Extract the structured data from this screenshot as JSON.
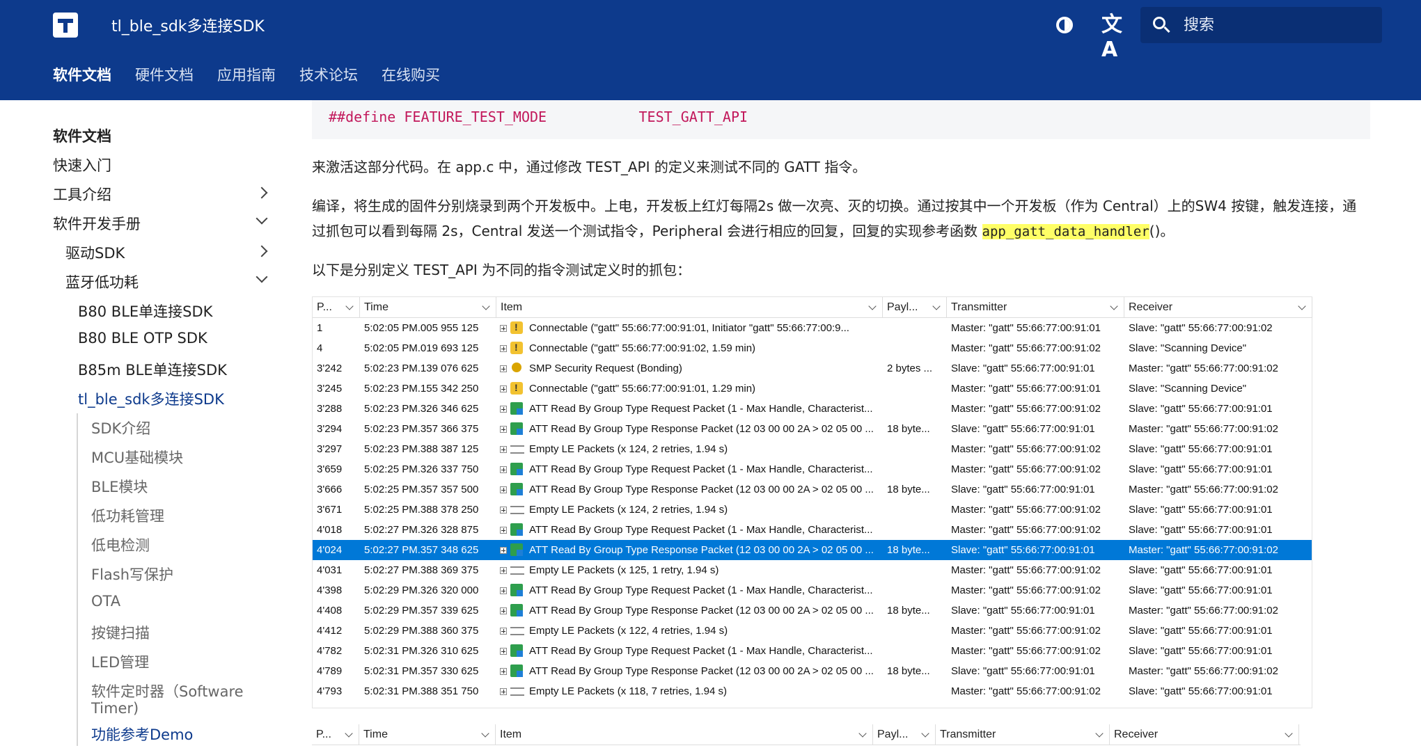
{
  "header": {
    "site_title": "tl_ble_sdk多连接SDK",
    "translate_glyph": "文A",
    "search_placeholder": "搜索",
    "tabs": [
      "软件文档",
      "硬件文档",
      "应用指南",
      "技术论坛",
      "在线购买"
    ]
  },
  "sidebar": {
    "items": [
      {
        "label": "软件文档"
      },
      {
        "label": "快速入门"
      },
      {
        "label": "工具介绍"
      },
      {
        "label": "软件开发手册"
      },
      {
        "label": "驱动SDK"
      },
      {
        "label": "蓝牙低功耗"
      },
      {
        "label": "B80 BLE单连接SDK"
      },
      {
        "label": "B80 BLE OTP SDK"
      },
      {
        "label": "B85m BLE单连接SDK"
      },
      {
        "label": "tl_ble_sdk多连接SDK"
      },
      {
        "label": "SDK介绍"
      },
      {
        "label": "MCU基础模块"
      },
      {
        "label": "BLE模块"
      },
      {
        "label": "低功耗管理"
      },
      {
        "label": "低电检测"
      },
      {
        "label": "Flash写保护"
      },
      {
        "label": "OTA"
      },
      {
        "label": "按键扫描"
      },
      {
        "label": "LED管理"
      },
      {
        "label": "软件定时器（Software"
      },
      {
        "label": "Timer)"
      },
      {
        "label": "功能参考Demo"
      }
    ]
  },
  "content": {
    "code_line": "##define FEATURE_TEST_MODE           TEST_GATT_API",
    "para1": "来激活这部分代码。在 app.c 中，通过修改 TEST_API 的定义来测试不同的 GATT 指令。",
    "para2_a": "编译，将生成的固件分别烧录到两个开发板中。上电，开发板上红灯每隔2s 做一次亮、灭的切换。通过按其中一个开发板（作为 Central）上的SW4 按键，触发连接，通过抓包可以看到每隔 2s，Central 发送一个测试指令，Peripheral 会进行相应的回复，回复的实现参考函数 ",
    "para2_code": "app_gatt_data_handler",
    "para2_b": "()。",
    "para3": "以下是分别定义 TEST_API 为不同的指令测试定义时的抓包："
  },
  "packet_table": {
    "columns": [
      "P...",
      "Time",
      "Item",
      "Payl...",
      "Transmitter",
      "Receiver"
    ],
    "selected_index": 11,
    "rows": [
      {
        "p": "1",
        "time": "5:02:05 PM.005 955 125",
        "icon": "connection-icon",
        "item": "Connectable (\"gatt\" 55:66:77:00:91:01, Initiator \"gatt\" 55:66:77:00:9...",
        "payload": "",
        "tx": "Master: \"gatt\" 55:66:77:00:91:01",
        "rx": "Slave: \"gatt\" 55:66:77:00:91:02"
      },
      {
        "p": "4",
        "time": "5:02:05 PM.019 693 125",
        "icon": "connection-icon",
        "item": "Connectable (\"gatt\" 55:66:77:00:91:02, 1.59 min)",
        "payload": "",
        "tx": "Master: \"gatt\" 55:66:77:00:91:02",
        "rx": "Slave: \"Scanning Device\""
      },
      {
        "p": "3'242",
        "time": "5:02:23 PM.139 076 625",
        "icon": "key-icon",
        "item": "SMP Security Request (Bonding)",
        "payload": "2 bytes ...",
        "tx": "Slave: \"gatt\" 55:66:77:00:91:01",
        "rx": "Master: \"gatt\" 55:66:77:00:91:02"
      },
      {
        "p": "3'245",
        "time": "5:02:23 PM.155 342 250",
        "icon": "connection-icon",
        "item": "Connectable (\"gatt\" 55:66:77:00:91:01, 1.29 min)",
        "payload": "",
        "tx": "Master: \"gatt\" 55:66:77:00:91:01",
        "rx": "Slave: \"Scanning Device\""
      },
      {
        "p": "3'288",
        "time": "5:02:23 PM.326 346 625",
        "icon": "att-icon",
        "item": "ATT Read By Group Type Request Packet (1 - Max Handle, Characterist...",
        "payload": "",
        "tx": "Master: \"gatt\" 55:66:77:00:91:02",
        "rx": "Slave: \"gatt\" 55:66:77:00:91:01"
      },
      {
        "p": "3'294",
        "time": "5:02:23 PM.357 366 375",
        "icon": "att-icon",
        "item": "ATT Read By Group Type Response Packet (12 03 00 00 2A > 02 05 00 ...",
        "payload": "18 byte...",
        "tx": "Slave: \"gatt\" 55:66:77:00:91:01",
        "rx": "Master: \"gatt\" 55:66:77:00:91:02"
      },
      {
        "p": "3'297",
        "time": "5:02:23 PM.388 387 125",
        "icon": "empty-packet-icon",
        "item": "Empty LE Packets (x 124, 2 retries, 1.94 s)",
        "payload": "",
        "tx": "Master: \"gatt\" 55:66:77:00:91:02",
        "rx": "Slave: \"gatt\" 55:66:77:00:91:01"
      },
      {
        "p": "3'659",
        "time": "5:02:25 PM.326 337 750",
        "icon": "att-icon",
        "item": "ATT Read By Group Type Request Packet (1 - Max Handle, Characterist...",
        "payload": "",
        "tx": "Master: \"gatt\" 55:66:77:00:91:02",
        "rx": "Slave: \"gatt\" 55:66:77:00:91:01"
      },
      {
        "p": "3'666",
        "time": "5:02:25 PM.357 357 500",
        "icon": "att-icon",
        "item": "ATT Read By Group Type Response Packet (12 03 00 00 2A > 02 05 00 ...",
        "payload": "18 byte...",
        "tx": "Slave: \"gatt\" 55:66:77:00:91:01",
        "rx": "Master: \"gatt\" 55:66:77:00:91:02"
      },
      {
        "p": "3'671",
        "time": "5:02:25 PM.388 378 250",
        "icon": "empty-packet-icon",
        "item": "Empty LE Packets (x 124, 2 retries, 1.94 s)",
        "payload": "",
        "tx": "Master: \"gatt\" 55:66:77:00:91:02",
        "rx": "Slave: \"gatt\" 55:66:77:00:91:01"
      },
      {
        "p": "4'018",
        "time": "5:02:27 PM.326 328 875",
        "icon": "att-icon",
        "item": "ATT Read By Group Type Request Packet (1 - Max Handle, Characterist...",
        "payload": "",
        "tx": "Master: \"gatt\" 55:66:77:00:91:02",
        "rx": "Slave: \"gatt\" 55:66:77:00:91:01"
      },
      {
        "p": "4'024",
        "time": "5:02:27 PM.357 348 625",
        "icon": "att-icon",
        "item": "ATT Read By Group Type Response Packet (12 03 00 00 2A > 02 05 00 ...",
        "payload": "18 byte...",
        "tx": "Slave: \"gatt\" 55:66:77:00:91:01",
        "rx": "Master: \"gatt\" 55:66:77:00:91:02"
      },
      {
        "p": "4'031",
        "time": "5:02:27 PM.388 369 375",
        "icon": "empty-packet-icon",
        "item": "Empty LE Packets (x 125, 1 retry, 1.94 s)",
        "payload": "",
        "tx": "Master: \"gatt\" 55:66:77:00:91:02",
        "rx": "Slave: \"gatt\" 55:66:77:00:91:01"
      },
      {
        "p": "4'398",
        "time": "5:02:29 PM.326 320 000",
        "icon": "att-icon",
        "item": "ATT Read By Group Type Request Packet (1 - Max Handle, Characterist...",
        "payload": "",
        "tx": "Master: \"gatt\" 55:66:77:00:91:02",
        "rx": "Slave: \"gatt\" 55:66:77:00:91:01"
      },
      {
        "p": "4'408",
        "time": "5:02:29 PM.357 339 625",
        "icon": "att-icon",
        "item": "ATT Read By Group Type Response Packet (12 03 00 00 2A > 02 05 00 ...",
        "payload": "18 byte...",
        "tx": "Slave: \"gatt\" 55:66:77:00:91:01",
        "rx": "Master: \"gatt\" 55:66:77:00:91:02"
      },
      {
        "p": "4'412",
        "time": "5:02:29 PM.388 360 375",
        "icon": "empty-packet-icon",
        "item": "Empty LE Packets (x 122, 4 retries, 1.94 s)",
        "payload": "",
        "tx": "Master: \"gatt\" 55:66:77:00:91:02",
        "rx": "Slave: \"gatt\" 55:66:77:00:91:01"
      },
      {
        "p": "4'782",
        "time": "5:02:31 PM.326 310 625",
        "icon": "att-icon",
        "item": "ATT Read By Group Type Request Packet (1 - Max Handle, Characterist...",
        "payload": "",
        "tx": "Master: \"gatt\" 55:66:77:00:91:02",
        "rx": "Slave: \"gatt\" 55:66:77:00:91:01"
      },
      {
        "p": "4'789",
        "time": "5:02:31 PM.357 330 625",
        "icon": "att-icon",
        "item": "ATT Read By Group Type Response Packet (12 03 00 00 2A > 02 05 00 ...",
        "payload": "18 byte...",
        "tx": "Slave: \"gatt\" 55:66:77:00:91:01",
        "rx": "Master: \"gatt\" 55:66:77:00:91:02"
      },
      {
        "p": "4'793",
        "time": "5:02:31 PM.388 351 750",
        "icon": "empty-packet-icon",
        "item": "Empty LE Packets (x 118, 7 retries, 1.94 s)",
        "payload": "",
        "tx": "Master: \"gatt\" 55:66:77:00:91:02",
        "rx": "Slave: \"gatt\" 55:66:77:00:91:01"
      }
    ]
  },
  "packet_table_2": {
    "columns": [
      "P...",
      "Time",
      "Item",
      "Payl...",
      "Transmitter",
      "Receiver"
    ]
  },
  "colors": {
    "header_bg": "#0d3a8c",
    "selection": "#0078d7",
    "code_pink": "#c2185b",
    "highlight": "#ffff66"
  }
}
